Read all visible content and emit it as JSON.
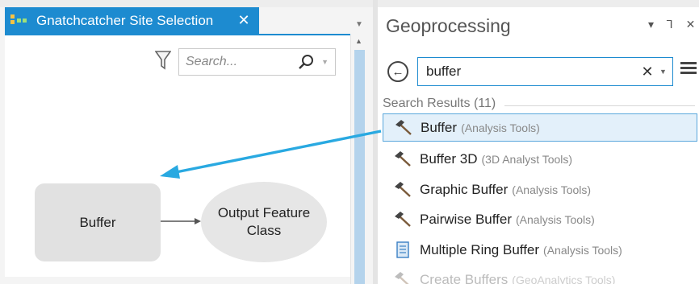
{
  "model_builder": {
    "tab_title": "Gnatchcatcher Site Selection",
    "tab_close": "✕",
    "dropdown_glyph": "▼",
    "search_placeholder": "Search...",
    "search_dropdown": "▼",
    "icons": {
      "tab": "model-icon",
      "filter": "filter-icon",
      "search": "search-icon"
    },
    "nodes": {
      "tool": "Buffer",
      "output": "Output Feature Class"
    }
  },
  "geoprocessing": {
    "title": "Geoprocessing",
    "controls": "▾ ⅂ ✕",
    "search_value": "buffer",
    "clear_glyph": "✕",
    "dropdown_glyph": "▼",
    "back_glyph": "←",
    "results_header": "Search Results (11)",
    "results": [
      {
        "name": "Buffer",
        "toolbox": "(Analysis Tools)",
        "icon": "hammer-icon",
        "selected": true
      },
      {
        "name": "Buffer 3D",
        "toolbox": "(3D Analyst Tools)",
        "icon": "hammer-icon"
      },
      {
        "name": "Graphic Buffer",
        "toolbox": "(Analysis Tools)",
        "icon": "hammer-icon"
      },
      {
        "name": "Pairwise Buffer",
        "toolbox": "(Analysis Tools)",
        "icon": "hammer-icon"
      },
      {
        "name": "Multiple Ring Buffer",
        "toolbox": "(Analysis Tools)",
        "icon": "script-icon"
      },
      {
        "name": "Create Buffers",
        "toolbox": "(GeoAnalytics Tools)",
        "icon": "hammer-icon"
      }
    ]
  },
  "colors": {
    "accent": "#1d8bd0",
    "annotation_arrow": "#29a9e1",
    "selection_bg": "#e3f0fa"
  }
}
